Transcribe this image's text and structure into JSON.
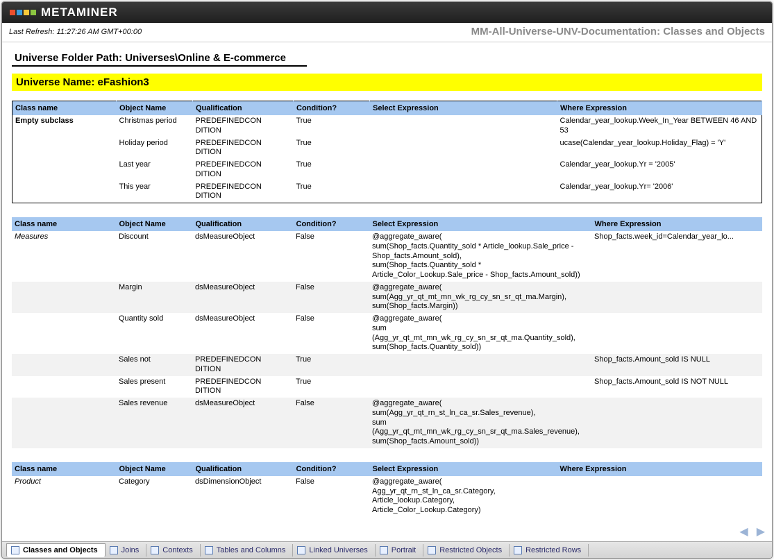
{
  "brand": "METAMINER",
  "logo_colors": [
    "#e94f2e",
    "#3a9bdc",
    "#f6c83a",
    "#8cc641"
  ],
  "refresh_label": "Last Refresh: 11:27:26 AM GMT+00:00",
  "doc_title": "MM-All-Universe-UNV-Documentation: Classes and Objects",
  "folder_path_label": "Universe Folder Path: Universes\\Online & E-commerce",
  "universe_name_label": "Universe Name: eFashion3",
  "columns": {
    "class_name": "Class name",
    "object_name": "Object Name",
    "qualification": "Qualification",
    "condition": "Condition?",
    "select_expr": "Select Expression",
    "where_expr": "Where Expression"
  },
  "table1": {
    "class_label": "Empty subclass",
    "rows": [
      {
        "obj": "Christmas period",
        "qual": "PREDEFINEDCONDITION",
        "cond": "True",
        "sel": "",
        "where": "Calendar_year_lookup.Week_In_Year BETWEEN 46  AND 53"
      },
      {
        "obj": "Holiday period",
        "qual": "PREDEFINEDCONDITION",
        "cond": "True",
        "sel": "",
        "where": "ucase(Calendar_year_lookup.Holiday_Flag) = 'Y'"
      },
      {
        "obj": "Last year",
        "qual": "PREDEFINEDCONDITION",
        "cond": "True",
        "sel": "",
        "where": "Calendar_year_lookup.Yr = '2005'"
      },
      {
        "obj": "This year",
        "qual": "PREDEFINEDCONDITION",
        "cond": "True",
        "sel": "",
        "where": "Calendar_year_lookup.Yr= '2006'"
      }
    ]
  },
  "table2": {
    "class_label": "Measures",
    "rows": [
      {
        "obj": "Discount",
        "qual": "dsMeasureObject",
        "cond": "False",
        "sel": "@aggregate_aware(\nsum(Shop_facts.Quantity_sold * Article_lookup.Sale_price - Shop_facts.Amount_sold),\nsum(Shop_facts.Quantity_sold * Article_Color_Lookup.Sale_price - Shop_facts.Amount_sold))",
        "where": "Shop_facts.week_id=Calendar_year_lo..."
      },
      {
        "obj": "Margin",
        "qual": "dsMeasureObject",
        "cond": "False",
        "sel": "@aggregate_aware(\nsum(Agg_yr_qt_mt_mn_wk_rg_cy_sn_sr_qt_ma.Margin),\nsum(Shop_facts.Margin))",
        "where": ""
      },
      {
        "obj": "Quantity sold",
        "qual": "dsMeasureObject",
        "cond": "False",
        "sel": "@aggregate_aware(\nsum\n(Agg_yr_qt_mt_mn_wk_rg_cy_sn_sr_qt_ma.Quantity_sold),\nsum(Shop_facts.Quantity_sold))",
        "where": ""
      },
      {
        "obj": "Sales not",
        "qual": "PREDEFINEDCONDITION",
        "cond": "True",
        "sel": "",
        "where": "Shop_facts.Amount_sold IS NULL"
      },
      {
        "obj": "Sales present",
        "qual": "PREDEFINEDCONDITION",
        "cond": "True",
        "sel": "",
        "where": "Shop_facts.Amount_sold IS NOT NULL"
      },
      {
        "obj": "Sales revenue",
        "qual": "dsMeasureObject",
        "cond": "False",
        "sel": "@aggregate_aware(\nsum(Agg_yr_qt_rn_st_ln_ca_sr.Sales_revenue),\nsum\n(Agg_yr_qt_mt_mn_wk_rg_cy_sn_sr_qt_ma.Sales_revenue),\nsum(Shop_facts.Amount_sold))",
        "where": ""
      }
    ]
  },
  "table3": {
    "class_label": "Product",
    "rows": [
      {
        "obj": "Category",
        "qual": "dsDimensionObject",
        "cond": "False",
        "sel": "@aggregate_aware(\nAgg_yr_qt_rn_st_ln_ca_sr.Category,\nArticle_lookup.Category,\nArticle_Color_Lookup.Category)",
        "where": ""
      }
    ]
  },
  "tabs": [
    {
      "label": "Classes and Objects",
      "active": true
    },
    {
      "label": "Joins",
      "active": false
    },
    {
      "label": "Contexts",
      "active": false
    },
    {
      "label": "Tables and Columns",
      "active": false
    },
    {
      "label": "Linked Universes",
      "active": false
    },
    {
      "label": "Portrait",
      "active": false
    },
    {
      "label": "Restricted Objects",
      "active": false
    },
    {
      "label": "Restricted Rows",
      "active": false
    }
  ]
}
